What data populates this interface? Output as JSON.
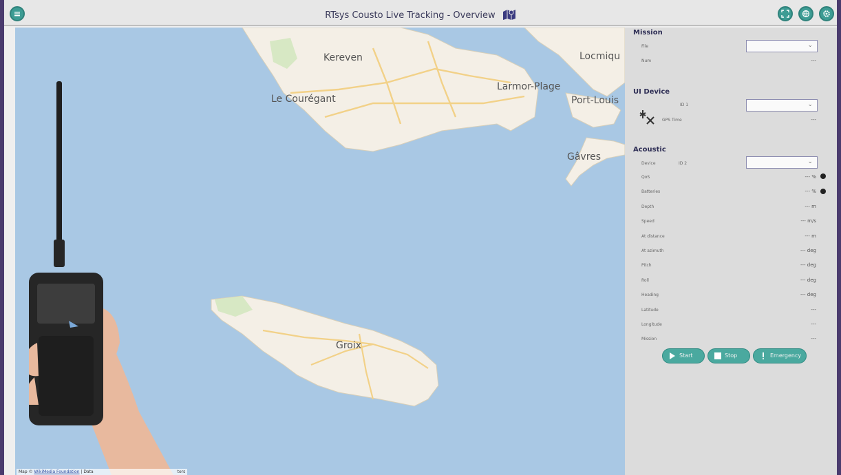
{
  "topbar": {
    "title": "RTsys Cousto Live Tracking  - Overview",
    "menu_icon": "menu-icon",
    "right_icons": [
      "fullscreen-icon",
      "globe-icon",
      "settings-icon"
    ]
  },
  "map": {
    "places": [
      "Kereven",
      "Locmiqu",
      "Larmor-Plage",
      "Le Courégant",
      "Port-Louis",
      "Gâvres",
      "Groix"
    ],
    "attribution_prefix": "Map ©",
    "attribution_link": "WikiMedia Foundation",
    "attribution_rest": "| Data",
    "attribution_tail": "tors"
  },
  "panel": {
    "mission": {
      "title": "Mission",
      "file_label": "File",
      "num_label": "Num",
      "num_value": "---"
    },
    "ui_device": {
      "title": "UI Device",
      "id_label": "ID 1",
      "gps_label": "GPS Time",
      "gps_value": "---"
    },
    "acoustic": {
      "title": "Acoustic",
      "device_label": "Device",
      "device_id": "ID 2",
      "rows": [
        {
          "label": "QoS",
          "value": "--- %"
        },
        {
          "label": "Batteries",
          "value": "--- %"
        },
        {
          "label": "Depth",
          "value": "--- m"
        },
        {
          "label": "Speed",
          "value": "--- m/s"
        },
        {
          "label": "At distance",
          "value": "--- m"
        },
        {
          "label": "At azimuth",
          "value": "--- deg"
        },
        {
          "label": "Pitch",
          "value": "--- deg"
        },
        {
          "label": "Roll",
          "value": "--- deg"
        },
        {
          "label": "Heading",
          "value": "--- deg"
        },
        {
          "label": "Latitude",
          "value": "---"
        },
        {
          "label": "Longitude",
          "value": "---"
        },
        {
          "label": "Mission",
          "value": "---"
        }
      ]
    },
    "buttons": {
      "start": "Start",
      "stop": "Stop",
      "emergency": "Emergency"
    }
  },
  "colors": {
    "accent": "#4aa99f",
    "frame": "#4a3b6e",
    "sea": "#a9c8e4",
    "land": "#f4efe6"
  }
}
